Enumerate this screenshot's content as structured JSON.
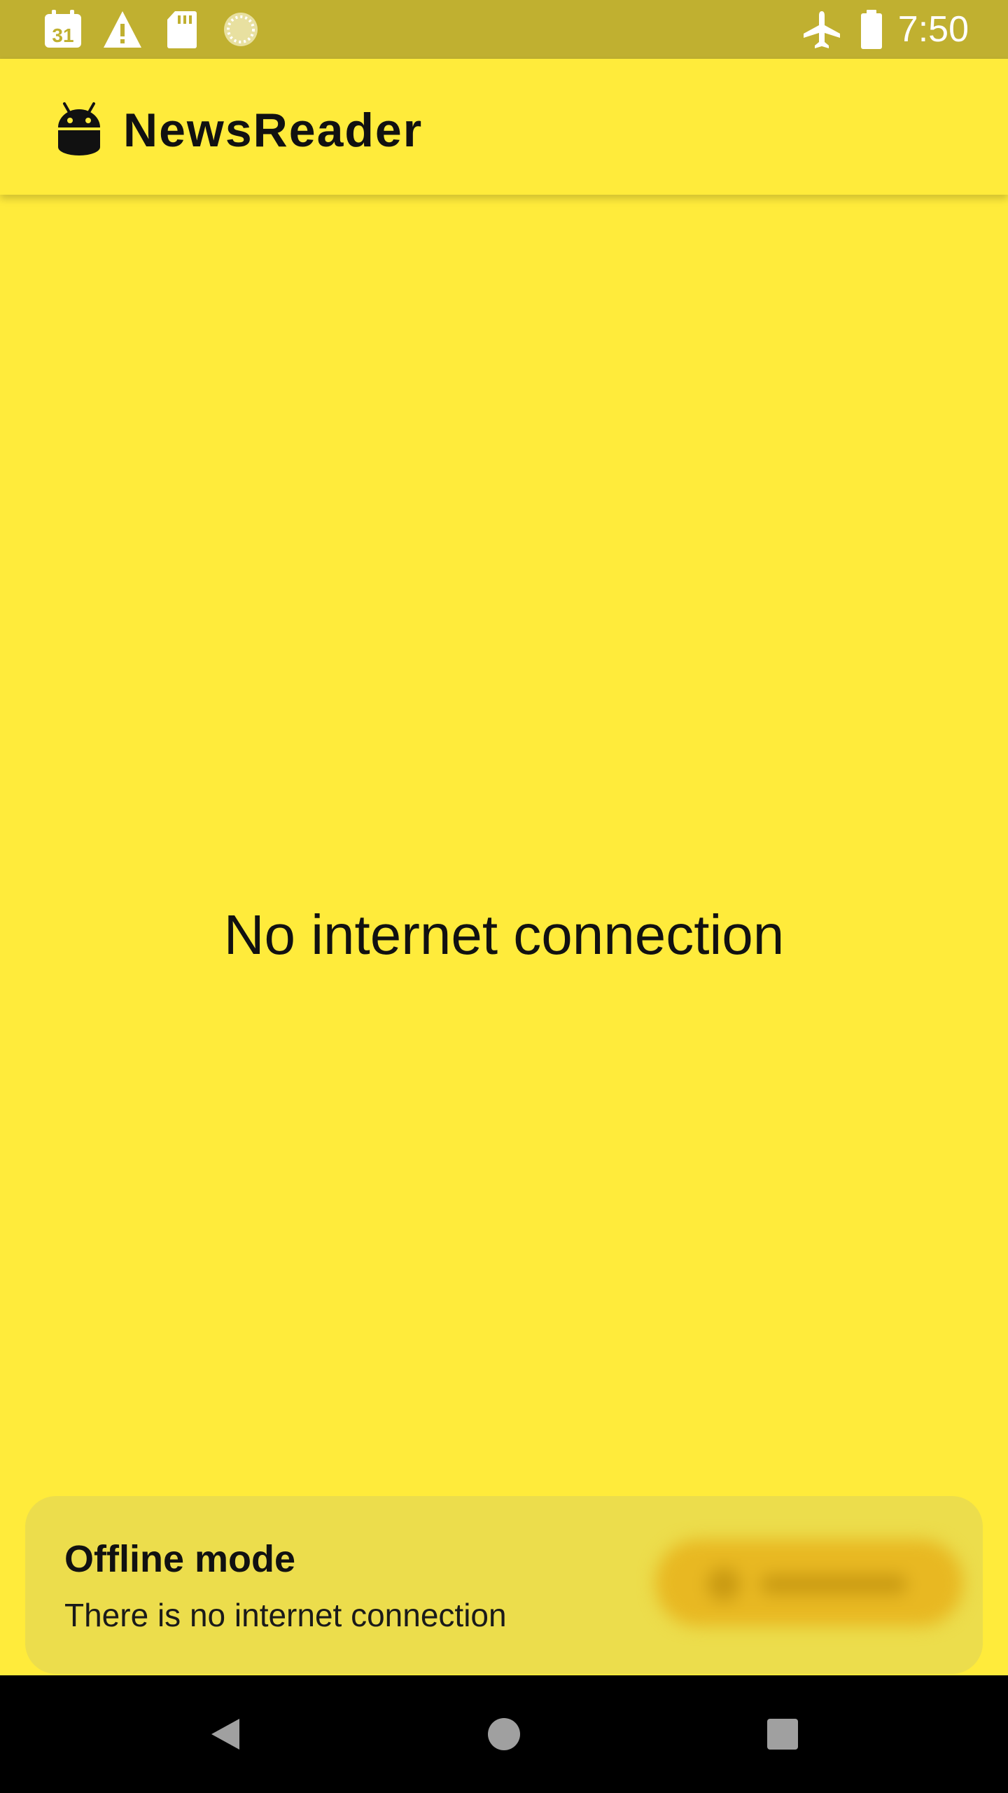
{
  "status_bar": {
    "calendar_date": "31",
    "time": "7:50",
    "left_icons": [
      "calendar-icon",
      "warning-icon",
      "sd-card-icon",
      "loading-spinner-icon"
    ],
    "right_icons": [
      "airplane-mode-icon",
      "battery-icon"
    ],
    "background_color": "#C0B030"
  },
  "app_bar": {
    "title": "NewsReader",
    "logo_icon": "android-robot-icon",
    "background_color": "#FFEB3B"
  },
  "main": {
    "message": "No internet connection"
  },
  "snackbar": {
    "title": "Offline mode",
    "text": "There is no internet connection",
    "action_state": "blurred",
    "background_color": "#ECDD4C"
  },
  "nav_bar": {
    "buttons": [
      "back-icon",
      "home-icon",
      "recents-icon"
    ]
  }
}
